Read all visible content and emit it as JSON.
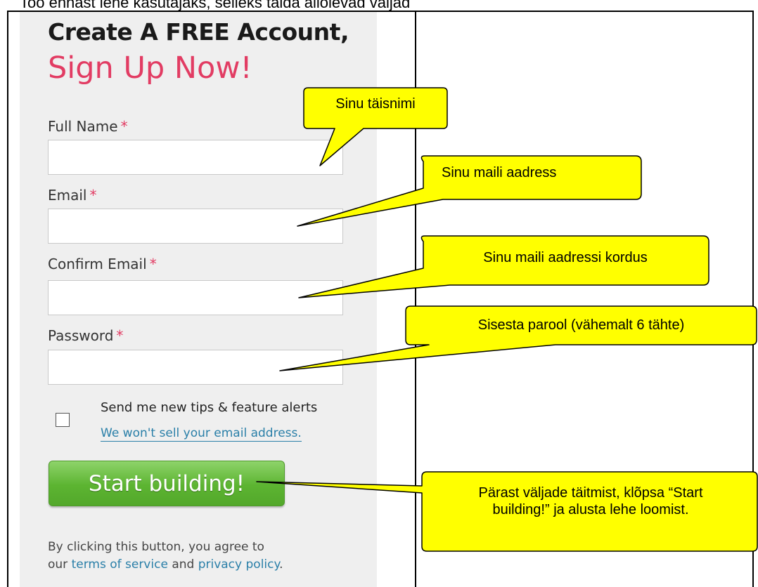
{
  "caption": "Too ennast lehe kasutajaks, selleks täida allolevad väljad",
  "form": {
    "heading_line1": "Create A FREE Account,",
    "heading_line2": "Sign Up Now!",
    "full_name_label": "Full Name",
    "email_label": "Email",
    "confirm_email_label": "Confirm Email",
    "password_label": "Password",
    "required_mark": "*",
    "full_name_value": "",
    "email_value": "",
    "confirm_email_value": "",
    "password_value": "",
    "newsletter_label": "Send me new tips & feature alerts",
    "newsletter_checked": false,
    "privacy_link": "We won't sell your email address.",
    "submit_label": "Start building!",
    "legal_prefix": "By clicking this button, you agree to",
    "legal_our": "our",
    "terms_link": "terms of service",
    "legal_and": "and",
    "privacy_policy_link": "privacy policy",
    "legal_period": "."
  },
  "callouts": [
    {
      "text": "Sinu täisnimi"
    },
    {
      "text": "Sinu maili aadress"
    },
    {
      "text": "Sinu maili aadressi kordus"
    },
    {
      "text": "Sisesta parool (vähemalt 6 tähte)"
    },
    {
      "text": "Pärast väljade täitmist, klõpsa “Start building!” ja alusta lehe loomist."
    }
  ],
  "colors": {
    "accent_pink": "#e23c63",
    "link_blue": "#2a7fa8",
    "button_green": "#5cb431",
    "callout_yellow": "#ffff00"
  }
}
